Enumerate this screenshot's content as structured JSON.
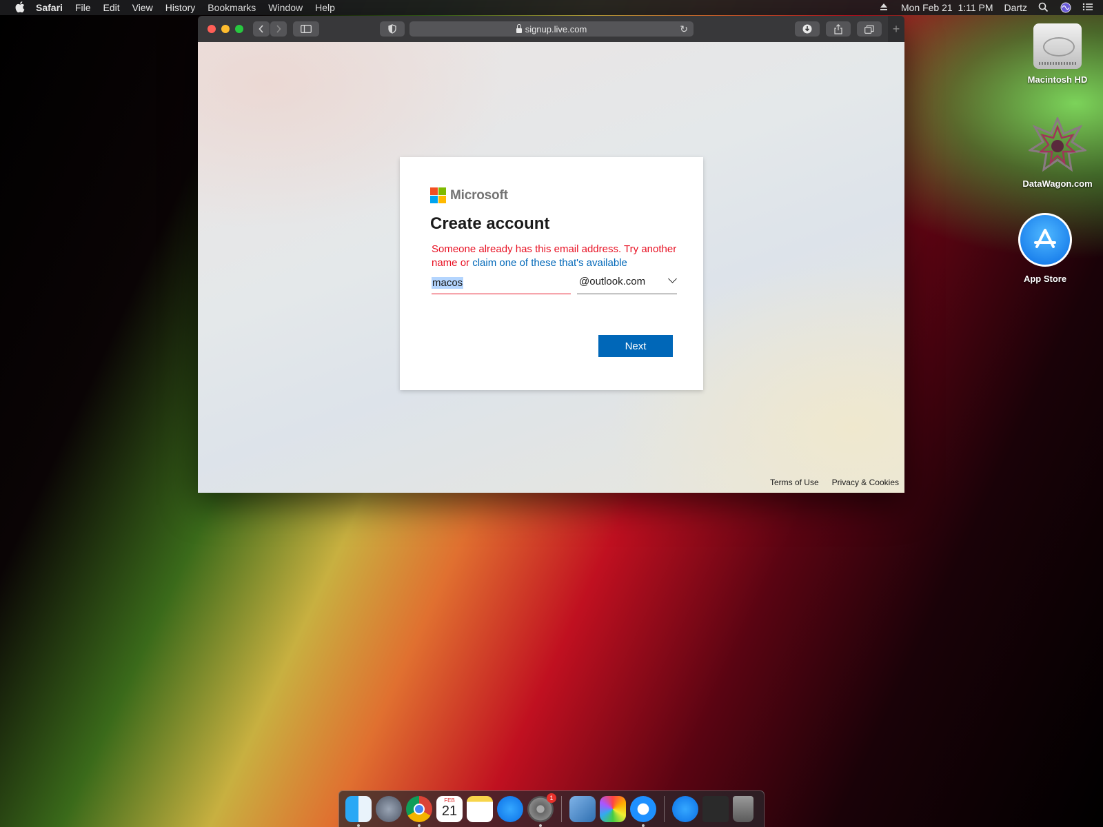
{
  "menubar": {
    "app_name": "Safari",
    "menus": [
      "File",
      "Edit",
      "View",
      "History",
      "Bookmarks",
      "Window",
      "Help"
    ],
    "clock": "Mon Feb 21  1:11 PM",
    "user": "Dartz"
  },
  "browser": {
    "url": "signup.live.com"
  },
  "signup": {
    "brand": "Microsoft",
    "title": "Create account",
    "error_text": "Someone already has this email address. Try another name or ",
    "error_link": "claim one of these that's available",
    "username_value": "macos",
    "domain_value": "@outlook.com",
    "next_label": "Next",
    "terms_label": "Terms of Use",
    "privacy_label": "Privacy & Cookies"
  },
  "desktop": {
    "icons": [
      "Macintosh HD",
      "DataWagon.com",
      "App Store"
    ]
  },
  "dock": {
    "items": [
      "finder-icon",
      "launchpad-icon",
      "chrome-icon",
      "calendar-icon",
      "notes-icon",
      "app-store-icon",
      "system-preferences-icon",
      "preview-icon",
      "photos-icon",
      "safari-icon",
      "app-store-icon",
      "screenshot-icon",
      "trash-icon"
    ],
    "calendar_day": "21",
    "calendar_month": "FEB",
    "system_preferences_badge": "1"
  },
  "colors": {
    "ms_red": "#f25022",
    "ms_green": "#7fba00",
    "ms_blue": "#00a4ef",
    "ms_yellow": "#ffb900",
    "error_red": "#e81123",
    "link_blue": "#0067b8",
    "button_blue": "#0067b8"
  }
}
